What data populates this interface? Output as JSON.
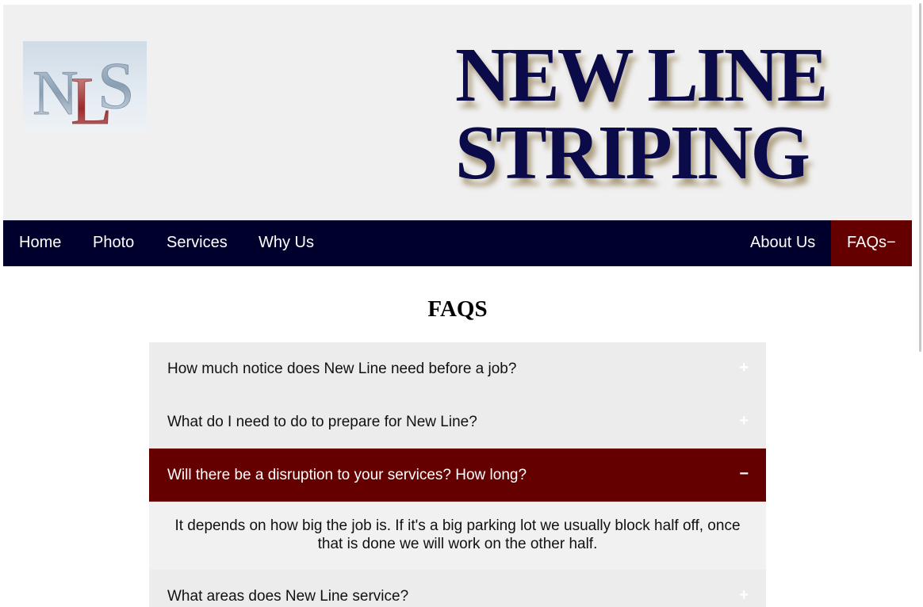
{
  "header": {
    "logo_text": "NLS",
    "brand_lines": [
      "NEW LINE",
      "STRIPING"
    ]
  },
  "nav": {
    "items": [
      "Home",
      "Photo",
      "Services",
      "Why Us"
    ],
    "right_items": [
      "About Us"
    ],
    "active_item": "FAQs−"
  },
  "main": {
    "heading": "FAQS",
    "faqs": [
      {
        "question": "How much notice does New Line need before a job?",
        "toggle": "+",
        "open": false
      },
      {
        "question": "What do I need to do to prepare for New Line?",
        "toggle": "+",
        "open": false
      },
      {
        "question": "Will there be a disruption to your services? How long?",
        "toggle": "−",
        "open": true,
        "answer": "It depends on how big the job is. If it's a big parking lot we usually block half off, once that is done we will work on the other half."
      },
      {
        "question": "What areas does New Line service?",
        "toggle": "+",
        "open": false
      }
    ]
  },
  "colors": {
    "navbar": "#00002d",
    "active": "#650000",
    "brand_text": "#0b0b4a",
    "header_bg": "#f0f0f0",
    "faq_bg": "#ececec"
  }
}
